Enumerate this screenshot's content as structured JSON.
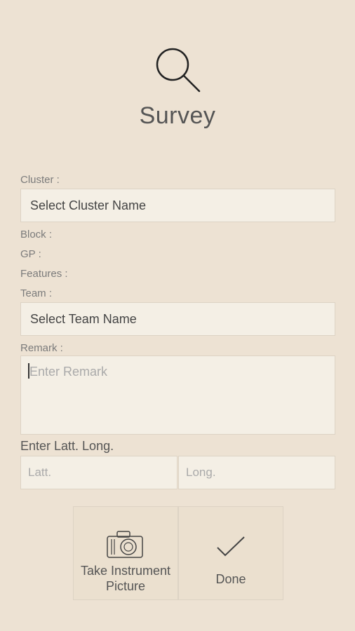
{
  "header": {
    "title": "Survey",
    "icon": "search-icon"
  },
  "form": {
    "cluster_label": "Cluster :",
    "cluster_select": "Select Cluster Name",
    "block_label": "Block :",
    "gp_label": "GP :",
    "features_label": "Features :",
    "team_label": "Team :",
    "team_select": "Select  Team Name",
    "remark_label": "Remark :",
    "remark_placeholder": "Enter Remark",
    "latlong_label": "Enter Latt. Long.",
    "latt_placeholder": "Latt.",
    "long_placeholder": "Long."
  },
  "actions": {
    "take_picture_label": "Take Instrument Picture",
    "take_picture_line1": "Take Instrument",
    "take_picture_line2": "Picture",
    "done_label": "Done"
  },
  "colors": {
    "background": "#ede2d3",
    "field": "#f4efe5",
    "border": "#ddd3c4"
  }
}
